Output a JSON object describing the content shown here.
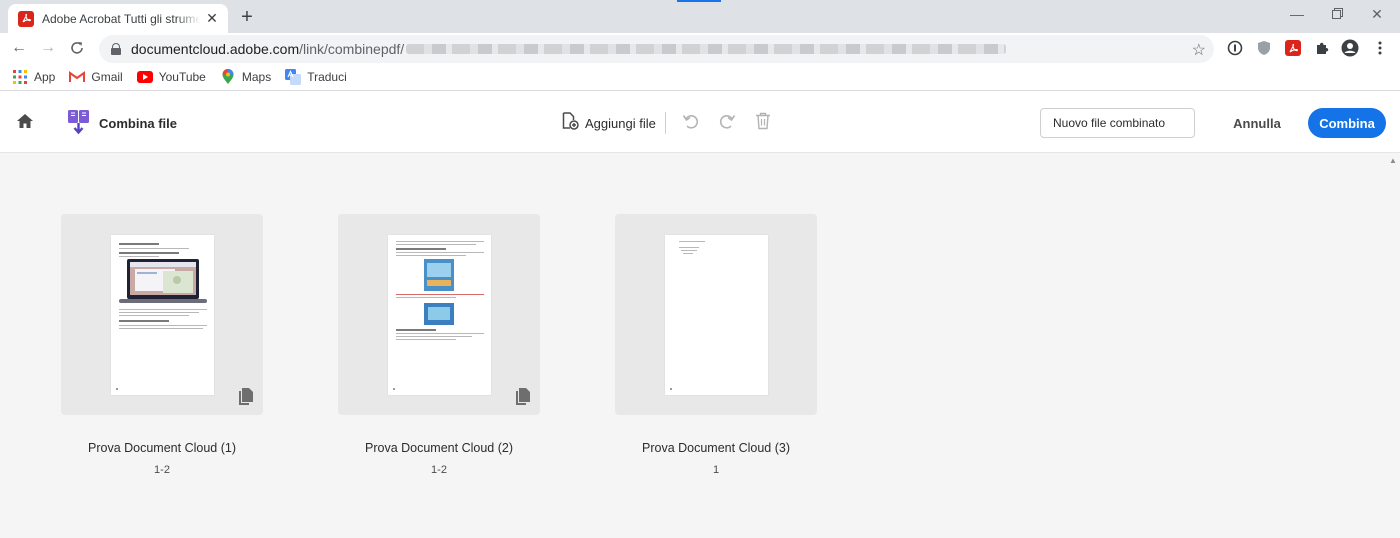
{
  "browser": {
    "tab_title": "Adobe Acrobat Tutti gli strumenti",
    "url_host": "documentcloud.adobe.com",
    "url_path": "/link/combinepdf/",
    "bookmarks": [
      {
        "label": "App",
        "icon": "apps-grid-icon"
      },
      {
        "label": "Gmail",
        "icon": "gmail-icon"
      },
      {
        "label": "YouTube",
        "icon": "youtube-icon"
      },
      {
        "label": "Maps",
        "icon": "maps-icon"
      },
      {
        "label": "Traduci",
        "icon": "translate-icon"
      }
    ]
  },
  "app": {
    "title": "Combina file",
    "add_file_label": "Aggiungi file",
    "output_name": "Nuovo file combinato",
    "cancel_label": "Annulla",
    "combine_label": "Combina",
    "accent_color": "#1473e6"
  },
  "files": [
    {
      "name": "Prova Document Cloud (1)",
      "pages": "1-2"
    },
    {
      "name": "Prova Document Cloud (2)",
      "pages": "1-2"
    },
    {
      "name": "Prova Document Cloud (3)",
      "pages": "1"
    }
  ]
}
